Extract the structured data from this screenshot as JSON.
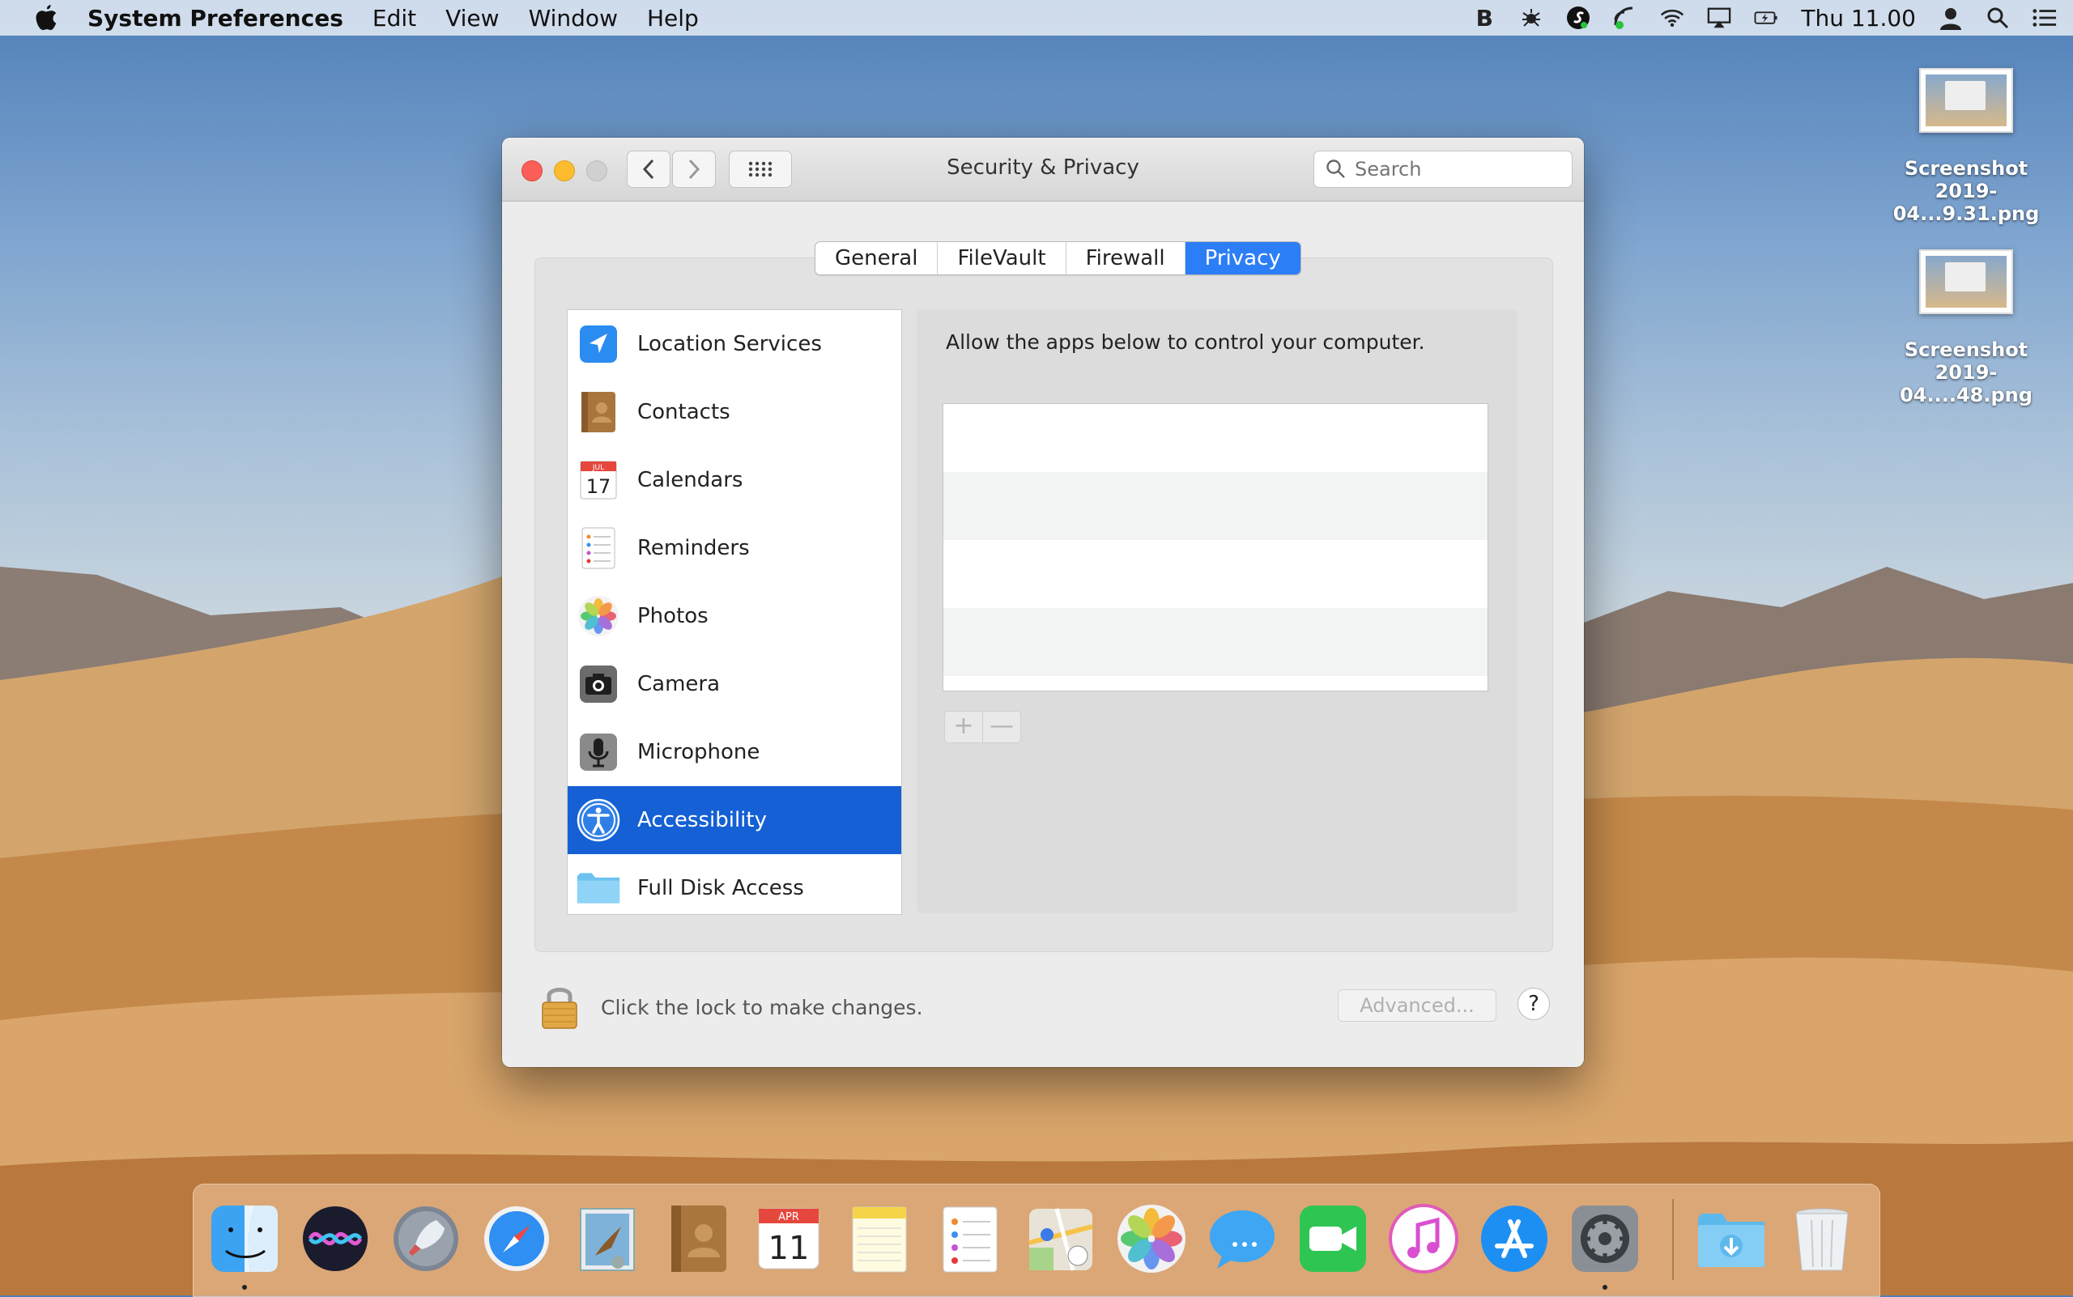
{
  "menubar": {
    "app_name": "System Preferences",
    "menus": [
      "Edit",
      "View",
      "Window",
      "Help"
    ],
    "clock": "Thu 11.00"
  },
  "desktop": {
    "files": [
      {
        "name": "Screenshot\n2019-04...9.31.png",
        "line1": "Screenshot",
        "line2": "2019-04...9.31.png"
      },
      {
        "name": "Screenshot\n2019-04....48.png",
        "line1": "Screenshot",
        "line2": "2019-04....48.png"
      }
    ]
  },
  "window": {
    "title": "Security & Privacy",
    "search_placeholder": "Search",
    "tabs": [
      {
        "label": "General",
        "active": false
      },
      {
        "label": "FileVault",
        "active": false
      },
      {
        "label": "Firewall",
        "active": false
      },
      {
        "label": "Privacy",
        "active": true
      }
    ],
    "privacy_list": [
      {
        "label": "Location Services",
        "icon": "location-arrow-icon"
      },
      {
        "label": "Contacts",
        "icon": "contacts-book-icon"
      },
      {
        "label": "Calendars",
        "icon": "calendar-icon",
        "icon_text": "17",
        "icon_month": "JUL"
      },
      {
        "label": "Reminders",
        "icon": "reminders-icon"
      },
      {
        "label": "Photos",
        "icon": "photos-flower-icon"
      },
      {
        "label": "Camera",
        "icon": "camera-icon"
      },
      {
        "label": "Microphone",
        "icon": "microphone-icon"
      },
      {
        "label": "Accessibility",
        "icon": "accessibility-icon",
        "selected": true
      },
      {
        "label": "Full Disk Access",
        "icon": "folder-icon"
      }
    ],
    "right_label": "Allow the apps below to control your computer.",
    "add_label": "+",
    "remove_label": "—",
    "lock_text": "Click the lock to make changes.",
    "advanced_label": "Advanced...",
    "help_label": "?"
  },
  "dock": {
    "apps": [
      "Finder",
      "Siri",
      "Launchpad",
      "Safari",
      "Mail",
      "Contacts",
      "Calendar",
      "Notes",
      "Reminders",
      "Maps",
      "Photos",
      "Messages",
      "FaceTime",
      "iTunes",
      "App Store",
      "System Preferences",
      "Downloads",
      "Trash"
    ],
    "calendar_month": "APR",
    "calendar_day": "11"
  },
  "colors": {
    "selection": "#1460d4",
    "tab_active": "#2c7ef6",
    "close": "#fc5f57",
    "minimize": "#fdbc2e"
  }
}
